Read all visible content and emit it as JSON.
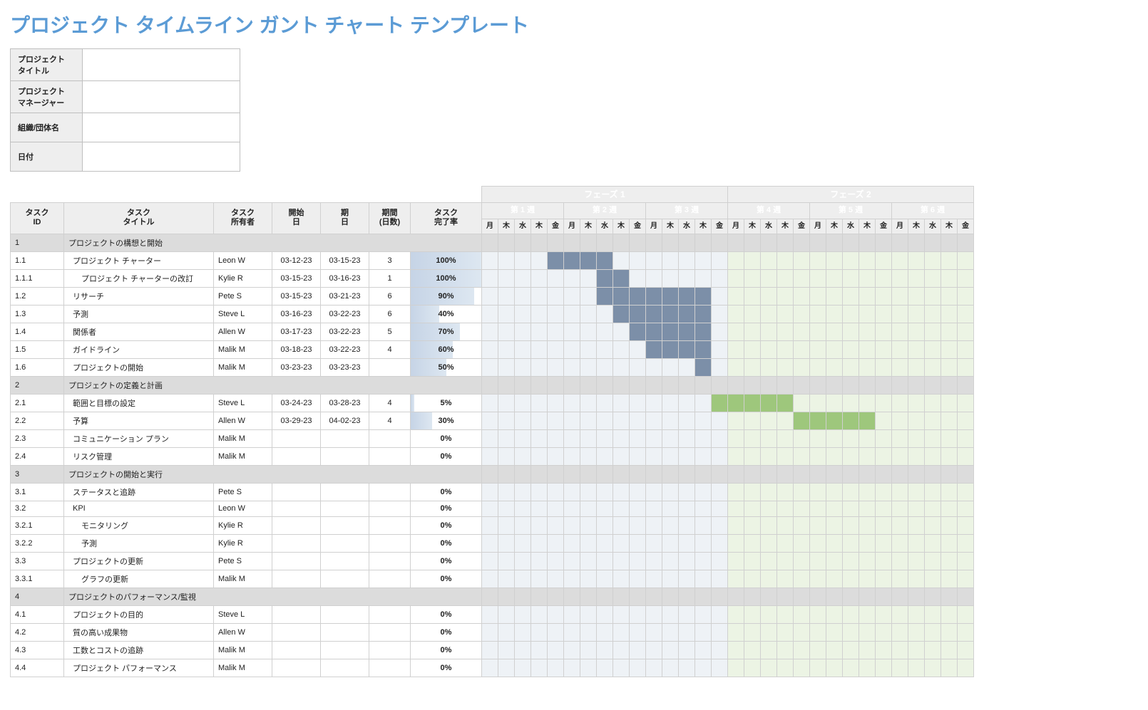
{
  "title": "プロジェクト タイムライン ガント チャート テンプレート",
  "meta_labels": {
    "project_title": "プロジェクト\nタイトル",
    "project_manager": "プロジェクト\nマネージャー",
    "org": "組織/団体名",
    "date": "日付"
  },
  "meta_values": {
    "project_title": "",
    "project_manager": "",
    "org": "",
    "date": ""
  },
  "columns": {
    "id": {
      "l1": "タスク",
      "l2": "ID"
    },
    "title": {
      "l1": "タスク",
      "l2": "タイトル"
    },
    "owner": {
      "l1": "タスク",
      "l2": "所有者"
    },
    "start": {
      "l1": "開始",
      "l2": "日"
    },
    "end": {
      "l1": "期",
      "l2": "日"
    },
    "duration": {
      "l1": "期間",
      "l2": "(日数)"
    },
    "pct": {
      "l1": "タスク",
      "l2": "完了率"
    }
  },
  "phases": [
    "フェーズ 1",
    "フェーズ 2"
  ],
  "weeks": [
    "第 1 週",
    "第 2 週",
    "第 3 週",
    "第 4 週",
    "第 5 週",
    "第 6 週"
  ],
  "dow": [
    "月",
    "木",
    "水",
    "木",
    "金"
  ],
  "rows": [
    {
      "type": "section",
      "id": "1",
      "title": "プロジェクトの構想と開始"
    },
    {
      "type": "task",
      "id": "1.1",
      "indent": 1,
      "title": "プロジェクト チャーター",
      "owner": "Leon W",
      "start": "03-12-23",
      "end": "03-15-23",
      "dur": "3",
      "pct": 100,
      "bar": {
        "phase": 1,
        "from": 5,
        "to": 8
      }
    },
    {
      "type": "task",
      "id": "1.1.1",
      "indent": 2,
      "title": "プロジェクト チャーターの改訂",
      "owner": "Kylie R",
      "start": "03-15-23",
      "end": "03-16-23",
      "dur": "1",
      "pct": 100,
      "bar": {
        "phase": 1,
        "from": 8,
        "to": 9
      }
    },
    {
      "type": "task",
      "id": "1.2",
      "indent": 1,
      "title": "リサーチ",
      "owner": "Pete S",
      "start": "03-15-23",
      "end": "03-21-23",
      "dur": "6",
      "pct": 90,
      "bar": {
        "phase": 1,
        "from": 8,
        "to": 14
      }
    },
    {
      "type": "task",
      "id": "1.3",
      "indent": 1,
      "title": "予測",
      "owner": "Steve L",
      "start": "03-16-23",
      "end": "03-22-23",
      "dur": "6",
      "pct": 40,
      "bar": {
        "phase": 1,
        "from": 9,
        "to": 14
      }
    },
    {
      "type": "task",
      "id": "1.4",
      "indent": 1,
      "title": "関係者",
      "owner": "Allen W",
      "start": "03-17-23",
      "end": "03-22-23",
      "dur": "5",
      "pct": 70,
      "bar": {
        "phase": 1,
        "from": 10,
        "to": 14
      }
    },
    {
      "type": "task",
      "id": "1.5",
      "indent": 1,
      "title": "ガイドライン",
      "owner": "Malik M",
      "start": "03-18-23",
      "end": "03-22-23",
      "dur": "4",
      "pct": 60,
      "bar": {
        "phase": 1,
        "from": 11,
        "to": 14
      }
    },
    {
      "type": "task",
      "id": "1.6",
      "indent": 1,
      "title": "プロジェクトの開始",
      "owner": "Malik M",
      "start": "03-23-23",
      "end": "03-23-23",
      "dur": "",
      "pct": 50,
      "bar": {
        "phase": 1,
        "from": 14,
        "to": 14
      }
    },
    {
      "type": "section",
      "id": "2",
      "title": "プロジェクトの定義と計画"
    },
    {
      "type": "task",
      "id": "2.1",
      "indent": 1,
      "title": "範囲と目標の設定",
      "owner": "Steve L",
      "start": "03-24-23",
      "end": "03-28-23",
      "dur": "4",
      "pct": 5,
      "bar": {
        "phase": 2,
        "from": 15,
        "to": 19
      }
    },
    {
      "type": "task",
      "id": "2.2",
      "indent": 1,
      "title": "予算",
      "owner": "Allen W",
      "start": "03-29-23",
      "end": "04-02-23",
      "dur": "4",
      "pct": 30,
      "bar": {
        "phase": 2,
        "from": 20,
        "to": 24
      }
    },
    {
      "type": "task",
      "id": "2.3",
      "indent": 1,
      "title": "コミュニケーション プラン",
      "owner": "Malik M",
      "start": "",
      "end": "",
      "dur": "",
      "pct": 0
    },
    {
      "type": "task",
      "id": "2.4",
      "indent": 1,
      "title": "リスク管理",
      "owner": "Malik M",
      "start": "",
      "end": "",
      "dur": "",
      "pct": 0
    },
    {
      "type": "section",
      "id": "3",
      "title": "プロジェクトの開始と実行"
    },
    {
      "type": "task",
      "id": "3.1",
      "indent": 1,
      "title": "ステータスと追跡",
      "owner": "Pete S",
      "start": "",
      "end": "",
      "dur": "",
      "pct": 0
    },
    {
      "type": "task",
      "id": "3.2",
      "indent": 1,
      "title": "KPI",
      "owner": "Leon W",
      "start": "",
      "end": "",
      "dur": "",
      "pct": 0
    },
    {
      "type": "task",
      "id": "3.2.1",
      "indent": 2,
      "title": "モニタリング",
      "owner": "Kylie R",
      "start": "",
      "end": "",
      "dur": "",
      "pct": 0
    },
    {
      "type": "task",
      "id": "3.2.2",
      "indent": 2,
      "title": "予測",
      "owner": "Kylie R",
      "start": "",
      "end": "",
      "dur": "",
      "pct": 0
    },
    {
      "type": "task",
      "id": "3.3",
      "indent": 1,
      "title": "プロジェクトの更新",
      "owner": "Pete S",
      "start": "",
      "end": "",
      "dur": "",
      "pct": 0
    },
    {
      "type": "task",
      "id": "3.3.1",
      "indent": 2,
      "title": "グラフの更新",
      "owner": "Malik M",
      "start": "",
      "end": "",
      "dur": "",
      "pct": 0
    },
    {
      "type": "section",
      "id": "4",
      "title": "プロジェクトのパフォーマンス/監視"
    },
    {
      "type": "task",
      "id": "4.1",
      "indent": 1,
      "title": "プロジェクトの目的",
      "owner": "Steve L",
      "start": "",
      "end": "",
      "dur": "",
      "pct": 0
    },
    {
      "type": "task",
      "id": "4.2",
      "indent": 1,
      "title": "質の高い成果物",
      "owner": "Allen W",
      "start": "",
      "end": "",
      "dur": "",
      "pct": 0
    },
    {
      "type": "task",
      "id": "4.3",
      "indent": 1,
      "title": "工数とコストの追跡",
      "owner": "Malik M",
      "start": "",
      "end": "",
      "dur": "",
      "pct": 0
    },
    {
      "type": "task",
      "id": "4.4",
      "indent": 1,
      "title": "プロジェクト パフォーマンス",
      "owner": "Malik M",
      "start": "",
      "end": "",
      "dur": "",
      "pct": 0
    }
  ],
  "chart_data": {
    "type": "gantt",
    "title": "プロジェクト タイムライン",
    "phases": [
      {
        "name": "フェーズ 1",
        "weeks": [
          "第 1 週",
          "第 2 週",
          "第 3 週"
        ],
        "days_per_week": 5,
        "color": "#7c8fa8"
      },
      {
        "name": "フェーズ 2",
        "weeks": [
          "第 4 週",
          "第 5 週",
          "第 6 週"
        ],
        "days_per_week": 5,
        "color": "#9ec77c"
      }
    ],
    "day_labels": [
      "月",
      "木",
      "水",
      "木",
      "金"
    ],
    "tasks": [
      {
        "id": "1.1",
        "title": "プロジェクト チャーター",
        "owner": "Leon W",
        "start": "03-12-23",
        "end": "03-15-23",
        "duration": 3,
        "pct_complete": 100,
        "phase": 1,
        "bar_start_day": 5,
        "bar_end_day": 8
      },
      {
        "id": "1.1.1",
        "title": "プロジェクト チャーターの改訂",
        "owner": "Kylie R",
        "start": "03-15-23",
        "end": "03-16-23",
        "duration": 1,
        "pct_complete": 100,
        "phase": 1,
        "bar_start_day": 8,
        "bar_end_day": 9
      },
      {
        "id": "1.2",
        "title": "リサーチ",
        "owner": "Pete S",
        "start": "03-15-23",
        "end": "03-21-23",
        "duration": 6,
        "pct_complete": 90,
        "phase": 1,
        "bar_start_day": 8,
        "bar_end_day": 14
      },
      {
        "id": "1.3",
        "title": "予測",
        "owner": "Steve L",
        "start": "03-16-23",
        "end": "03-22-23",
        "duration": 6,
        "pct_complete": 40,
        "phase": 1,
        "bar_start_day": 9,
        "bar_end_day": 14
      },
      {
        "id": "1.4",
        "title": "関係者",
        "owner": "Allen W",
        "start": "03-17-23",
        "end": "03-22-23",
        "duration": 5,
        "pct_complete": 70,
        "phase": 1,
        "bar_start_day": 10,
        "bar_end_day": 14
      },
      {
        "id": "1.5",
        "title": "ガイドライン",
        "owner": "Malik M",
        "start": "03-18-23",
        "end": "03-22-23",
        "duration": 4,
        "pct_complete": 60,
        "phase": 1,
        "bar_start_day": 11,
        "bar_end_day": 14
      },
      {
        "id": "1.6",
        "title": "プロジェクトの開始",
        "owner": "Malik M",
        "start": "03-23-23",
        "end": "03-23-23",
        "duration": 0,
        "pct_complete": 50,
        "phase": 1,
        "bar_start_day": 14,
        "bar_end_day": 14
      },
      {
        "id": "2.1",
        "title": "範囲と目標の設定",
        "owner": "Steve L",
        "start": "03-24-23",
        "end": "03-28-23",
        "duration": 4,
        "pct_complete": 5,
        "phase": 2,
        "bar_start_day": 15,
        "bar_end_day": 19
      },
      {
        "id": "2.2",
        "title": "予算",
        "owner": "Allen W",
        "start": "03-29-23",
        "end": "04-02-23",
        "duration": 4,
        "pct_complete": 30,
        "phase": 2,
        "bar_start_day": 20,
        "bar_end_day": 24
      },
      {
        "id": "2.3",
        "title": "コミュニケーション プラン",
        "owner": "Malik M",
        "pct_complete": 0
      },
      {
        "id": "2.4",
        "title": "リスク管理",
        "owner": "Malik M",
        "pct_complete": 0
      },
      {
        "id": "3.1",
        "title": "ステータスと追跡",
        "owner": "Pete S",
        "pct_complete": 0
      },
      {
        "id": "3.2",
        "title": "KPI",
        "owner": "Leon W",
        "pct_complete": 0
      },
      {
        "id": "3.2.1",
        "title": "モニタリング",
        "owner": "Kylie R",
        "pct_complete": 0
      },
      {
        "id": "3.2.2",
        "title": "予測",
        "owner": "Kylie R",
        "pct_complete": 0
      },
      {
        "id": "3.3",
        "title": "プロジェクトの更新",
        "owner": "Pete S",
        "pct_complete": 0
      },
      {
        "id": "3.3.1",
        "title": "グラフの更新",
        "owner": "Malik M",
        "pct_complete": 0
      },
      {
        "id": "4.1",
        "title": "プロジェクトの目的",
        "owner": "Steve L",
        "pct_complete": 0
      },
      {
        "id": "4.2",
        "title": "質の高い成果物",
        "owner": "Allen W",
        "pct_complete": 0
      },
      {
        "id": "4.3",
        "title": "工数とコストの追跡",
        "owner": "Malik M",
        "pct_complete": 0
      },
      {
        "id": "4.4",
        "title": "プロジェクト パフォーマンス",
        "owner": "Malik M",
        "pct_complete": 0
      }
    ]
  }
}
